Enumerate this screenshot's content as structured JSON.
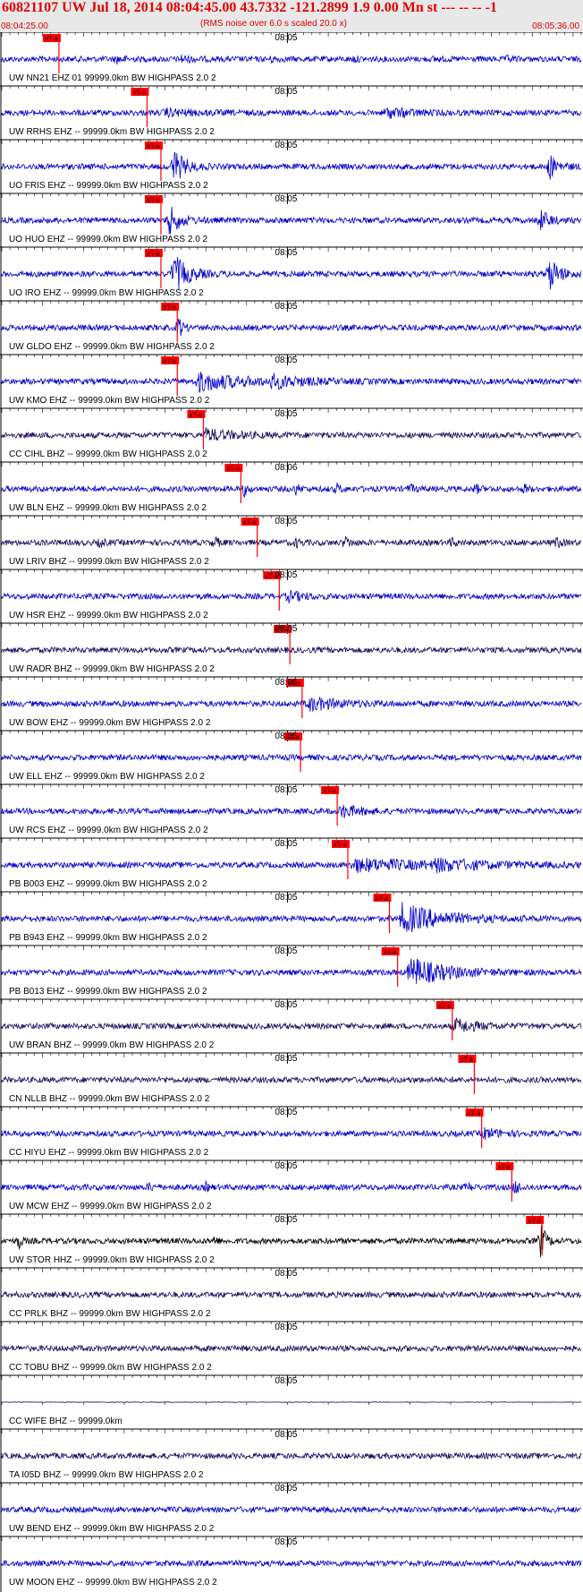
{
  "header": {
    "title": "60821107 UW Jul 18, 2014 08:04:45.00   43.7332 -121.2899  1.9 0.00 Mn st --- -- --   -1",
    "subtitle": "(RMS noise over 6.0 s scaled 20.0 x)",
    "start_time": "08:04:25.00",
    "end_time": "08:05:36.00"
  },
  "chart_data": {
    "type": "line",
    "title": "60821107 UW Jul 18, 2014 08:04:45.00   43.7332 -121.2899  1.9 0.00 Mn st --- -- --   -1",
    "subtitle": "(RMS noise over 6.0 s scaled 20.0 x)",
    "time_range": [
      "08:04:25.00",
      "08:05:36.00"
    ],
    "x_unit": "seconds after 08:04:25.00",
    "xlim": [
      0,
      71
    ],
    "minute_tick_seconds": 35,
    "second_ticks": true,
    "pick_label": "xT-a",
    "colors": {
      "blue": "#0000cc",
      "dark": "#1a0a5c",
      "black": "#000000",
      "pick": "#ff0000"
    },
    "series": [
      {
        "label": "UW NN21 EHZ 01 99999.0km BW  HIGHPASS  2.0  2",
        "tick": "08:05",
        "pick": 7.0,
        "color": "blue",
        "bursts": [
          [
            14,
            0.8,
            1.2
          ],
          [
            22,
            1.2,
            1.0
          ],
          [
            33,
            0.6,
            0.8
          ],
          [
            43,
            0.5,
            0.9
          ],
          [
            53,
            0.6,
            0.7
          ],
          [
            62,
            0.5,
            0.8
          ]
        ]
      },
      {
        "label": "UW RRHS EHZ -- 99999.0km BW  HIGHPASS  2.0  2",
        "tick": "08:05",
        "pick": 17.8,
        "color": "blue",
        "bursts": [
          [
            20,
            3.5,
            1.0
          ],
          [
            47,
            3.0,
            1.6
          ]
        ]
      },
      {
        "label": "UO FRIS EHZ -- 99999.0km BW  HIGHPASS  2.0  2",
        "tick": "08:05",
        "pick": 19.5,
        "color": "blue",
        "bursts": [
          [
            21,
            1.3,
            6.0
          ],
          [
            67,
            1.0,
            4.5
          ]
        ]
      },
      {
        "label": "UO HUO EHZ -- 99999.0km BW  HIGHPASS  2.0  2",
        "tick": "08:05",
        "pick": 19.5,
        "color": "blue",
        "bursts": [
          [
            20.5,
            1.3,
            5.0
          ],
          [
            66,
            1.0,
            3.5
          ]
        ]
      },
      {
        "label": "UO IRO EHZ -- 99999.0km BW  HIGHPASS  2.0  2",
        "tick": "08:05",
        "pick": 19.5,
        "color": "blue",
        "bursts": [
          [
            21,
            1.6,
            7.0
          ],
          [
            67,
            1.2,
            6.0
          ]
        ]
      },
      {
        "label": "UW GLDO EHZ -- 99999.0km BW  HIGHPASS  2.0  2",
        "tick": "08:05",
        "pick": 21.5,
        "color": "blue",
        "bursts": [
          [
            21.6,
            0.5,
            4.0
          ]
        ]
      },
      {
        "label": "UW KMO EHZ -- 99999.0km BW  HIGHPASS  2.0  2",
        "tick": "08:05",
        "pick": 21.5,
        "color": "blue",
        "bursts": [
          [
            24,
            5.0,
            3.2
          ],
          [
            33,
            3.5,
            1.8
          ]
        ]
      },
      {
        "label": "CC CIHL BHZ -- 99999.0km BW  HIGHPASS  2.0  2",
        "tick": "08:05",
        "pick": 24.7,
        "color": "dark",
        "bursts": [
          [
            25,
            3.5,
            1.8
          ]
        ]
      },
      {
        "label": "UW BLN EHZ -- 99999.0km BW  HIGHPASS  2.0  2",
        "tick": "08:06",
        "pick": 29.3,
        "color": "blue",
        "bursts": [
          [
            29.6,
            0.4,
            3.0
          ],
          [
            36,
            0.4,
            2.0
          ],
          [
            41,
            0.4,
            1.8
          ],
          [
            50,
            0.4,
            1.6
          ],
          [
            58,
            0.4,
            1.8
          ],
          [
            64,
            0.4,
            1.6
          ]
        ]
      },
      {
        "label": "UW LRIV BHZ -- 99999.0km BW  HIGHPASS  2.0  2",
        "tick": "08:05",
        "pick": 31.3,
        "color": "dark",
        "bursts": [
          [
            12,
            0.5,
            1.8
          ],
          [
            26,
            0.5,
            2.0
          ],
          [
            36,
            0.5,
            1.5
          ],
          [
            42,
            0.6,
            2.2
          ],
          [
            55,
            0.5,
            1.5
          ],
          [
            68,
            0.4,
            2.5
          ]
        ]
      },
      {
        "label": "UW HSR EHZ -- 99999.0km BW  HIGHPASS  2.0  2",
        "tick": "08:05",
        "pick": 34.0,
        "color": "blue",
        "bursts": [
          [
            35,
            2.0,
            1.5
          ]
        ]
      },
      {
        "label": "UW RADR BHZ -- 99999.0km BW  HIGHPASS  2.0  2",
        "tick": "08:05",
        "pick": 35.3,
        "color": "dark",
        "bursts": []
      },
      {
        "label": "UW BOW EHZ -- 99999.0km BW  HIGHPASS  2.0  2",
        "tick": "08:05",
        "pick": 36.8,
        "color": "blue",
        "bursts": [
          [
            37.5,
            3.5,
            2.2
          ]
        ]
      },
      {
        "label": "UW ELL EHZ -- 99999.0km BW  HIGHPASS  2.0  2",
        "tick": "08:05",
        "pick": 36.6,
        "color": "blue",
        "bursts": []
      },
      {
        "label": "UW RCS EHZ -- 99999.0km BW  HIGHPASS  2.0  2",
        "tick": "08:05",
        "pick": 41.1,
        "color": "blue",
        "bursts": [
          [
            41.5,
            2.0,
            2.2
          ]
        ]
      },
      {
        "label": "PB B003 EHZ -- 99999.0km BW  HIGHPASS  2.0  2",
        "tick": "08:05",
        "pick": 42.4,
        "color": "blue",
        "bursts": [
          [
            43,
            9.0,
            2.0
          ],
          [
            53,
            5.0,
            1.5
          ]
        ]
      },
      {
        "label": "PB B943 EHZ -- 99999.0km BW  HIGHPASS  2.0  2",
        "tick": "08:05",
        "pick": 47.5,
        "color": "blue",
        "bursts": [
          [
            49,
            4.5,
            5.0
          ]
        ]
      },
      {
        "label": "PB B013 EHZ -- 99999.0km BW  HIGHPASS  2.0  2",
        "tick": "08:05",
        "pick": 48.5,
        "color": "blue",
        "bursts": [
          [
            50,
            4.0,
            5.0
          ]
        ]
      },
      {
        "label": "UW BRAN BHZ -- 99999.0km BW  HIGHPASS  2.0  2",
        "tick": "08:05",
        "pick": 55.2,
        "color": "dark",
        "bursts": [
          [
            55.5,
            2.5,
            2.2
          ]
        ]
      },
      {
        "label": "CN NLLB BHZ -- 99999.0km BW  HIGHPASS  2.0  2",
        "tick": "08:05",
        "pick": 57.9,
        "color": "dark",
        "bursts": []
      },
      {
        "label": "CC HIYU EHZ -- 99999.0km BW  HIGHPASS  2.0  2",
        "tick": "08:05",
        "pick": 58.8,
        "color": "blue",
        "bursts": [
          [
            59,
            2.0,
            1.6
          ]
        ]
      },
      {
        "label": "UW MCW EHZ -- 99999.0km BW  HIGHPASS  2.0  2",
        "tick": "08:05",
        "pick": 62.5,
        "color": "blue",
        "bursts": [
          [
            18,
            0.4,
            1.6
          ],
          [
            25,
            0.4,
            1.4
          ],
          [
            57,
            0.4,
            1.8
          ],
          [
            62.8,
            0.5,
            3.0
          ]
        ]
      },
      {
        "label": "UW STOR HHZ -- 99999.0km BW  HIGHPASS  2.0  2",
        "tick": "08:05",
        "pick": 66.2,
        "color": "black",
        "bursts": [
          [
            2,
            0.3,
            4.0
          ],
          [
            66,
            0.6,
            6.0
          ],
          [
            26,
            0.3,
            1.8
          ]
        ]
      },
      {
        "label": "CC PRLK BHZ -- 99999.0km BW  HIGHPASS  2.0  2",
        "tick": "08:05",
        "pick": null,
        "color": "dark",
        "bursts": []
      },
      {
        "label": "CC TOBU BHZ -- 99999.0km BW  HIGHPASS  2.0  2",
        "tick": "08:05",
        "pick": null,
        "color": "dark",
        "bursts": []
      },
      {
        "label": "CC WIFE BHZ -- 99999.0km",
        "tick": "08:05",
        "pick": null,
        "color": "dark",
        "bursts": [],
        "flat": true
      },
      {
        "label": "TA I05D BHZ -- 99999.0km BW  HIGHPASS  2.0  2",
        "tick": "08:05",
        "pick": null,
        "color": "dark",
        "bursts": []
      },
      {
        "label": "UW BEND EHZ -- 99999.0km BW  HIGHPASS  2.0  2",
        "tick": "08:05",
        "pick": null,
        "color": "blue",
        "bursts": []
      },
      {
        "label": "UW MOON EHZ -- 99999.0km BW  HIGHPASS  2.0  2",
        "tick": "08:05",
        "pick": null,
        "color": "blue",
        "bursts": []
      }
    ]
  }
}
